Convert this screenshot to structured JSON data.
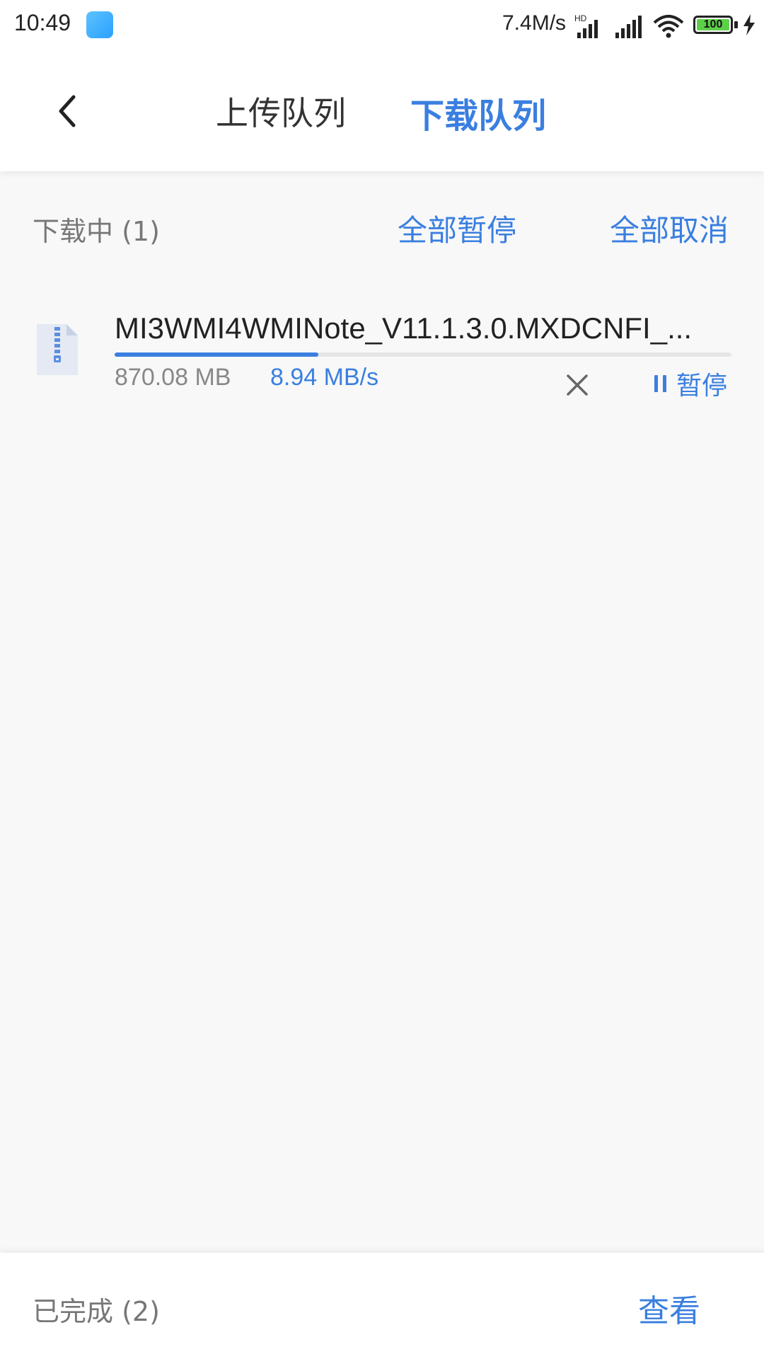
{
  "status_bar": {
    "time": "10:49",
    "net_speed": "7.4M/s",
    "network_badge": "HD",
    "battery_level": "100",
    "icons": [
      "app-notification-icon",
      "signal-hd-icon",
      "signal-icon",
      "wifi-icon",
      "battery-icon",
      "charging-icon"
    ]
  },
  "header": {
    "back_icon": "chevron-left-icon",
    "tabs": [
      {
        "label": "上传队列",
        "active": false
      },
      {
        "label": "下载队列",
        "active": true
      }
    ]
  },
  "downloading": {
    "title": "下载中 (1)",
    "pause_all_label": "全部暂停",
    "cancel_all_label": "全部取消",
    "items": [
      {
        "file_icon": "zip-file-icon",
        "name": "MI3WMI4WMINote_V11.1.3.0.MXDCNFI_...",
        "size": "870.08 MB",
        "speed": "8.94 MB/s",
        "progress_fraction": 0.33,
        "cancel_icon": "close-icon",
        "pause_label": "暂停",
        "pause_icon": "pause-icon"
      }
    ]
  },
  "completed": {
    "title": "已完成 (2)",
    "view_label": "查看"
  },
  "colors": {
    "accent": "#3a7fe0",
    "background": "#f8f8f8"
  }
}
